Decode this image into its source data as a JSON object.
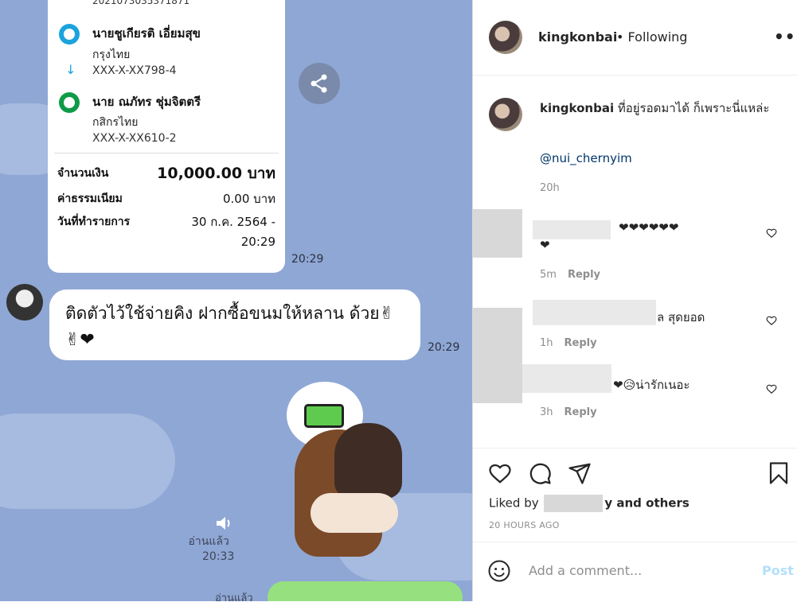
{
  "chat": {
    "receipt": {
      "ref": "2021073035371871",
      "sender_name": "นายชูเกียรติ เอี่ยมสุข",
      "sender_bank": "กรุงไทย",
      "sender_account": "XXX-X-XX798-4",
      "receiver_name": "นาย ณภัทร ชุ่มจิตตรี",
      "receiver_bank": "กสิกรไทย",
      "receiver_account": "XXX-X-XX610-2",
      "amount_label": "จำนวนเงิน",
      "amount_value": "10,000.00 บาท",
      "fee_label": "ค่าธรรมเนียม",
      "fee_value": "0.00 บาท",
      "date_label": "วันที่ทำรายการ",
      "date_value": "30 ก.ค. 2564 -",
      "date_time": "20:29"
    },
    "receipt_time": "20:29",
    "message_text": "ติดตัวไว้ใช้จ่ายคิง ฝากซื้อขนมให้หลาน ด้วย",
    "message_emoji": "✌✌❤",
    "message_time": "20:29",
    "read_label": "อ่านแล้ว",
    "sticker_time": "20:33",
    "read_label_2": "อ่านแล้ว"
  },
  "ig": {
    "username": "kingkonbai",
    "following": "• Following",
    "more": "•••",
    "caption_user": "kingkonbai",
    "caption_text": "ที่อยู่รอดมาได้ ก็เพราะนี่แหล่ะ",
    "mention": "@nui_chernyim",
    "caption_age": "20h",
    "comments": [
      {
        "text": "❤❤❤❤❤❤",
        "text2": "❤",
        "age": "5m",
        "reply": "Reply"
      },
      {
        "text": "ล สุดยอด",
        "age": "1h",
        "reply": "Reply"
      },
      {
        "text": "❤😥น่ารักเนอะ",
        "age": "3h",
        "reply": "Reply"
      }
    ],
    "liked_by": "Liked by",
    "and_others": "y and others",
    "time_ago": "20 HOURS AGO",
    "add_comment_placeholder": "Add a comment...",
    "post_label": "Post"
  }
}
